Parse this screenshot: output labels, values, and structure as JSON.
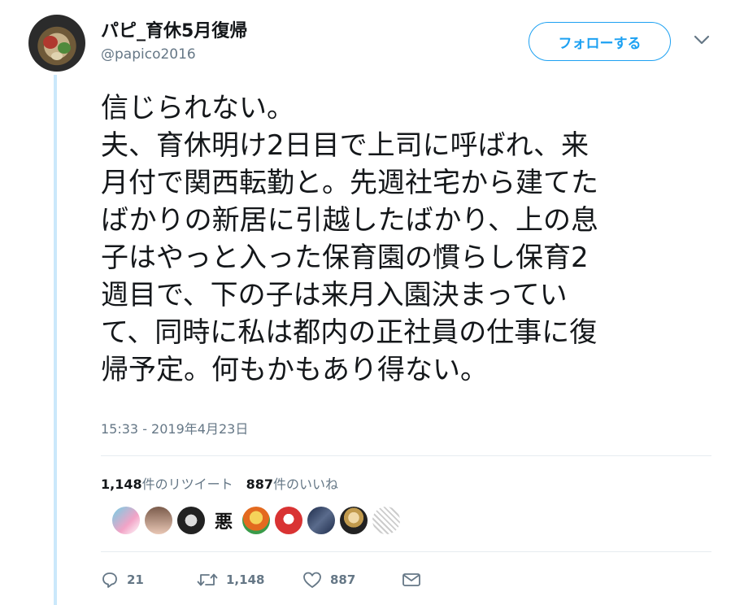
{
  "author": {
    "display_name": "パピ_育休5月復帰",
    "handle": "@papico2016"
  },
  "follow_button": {
    "label": "フォローする"
  },
  "tweet": {
    "lines": [
      "信じられない。",
      "夫、育休明け2日目で上司に呼ばれ、来",
      "月付で関西転勤と。先週社宅から建てた",
      "ばかりの新居に引越したばかり、上の息",
      "子はやっと入った保育園の慣らし保育2",
      "週目で、下の子は来月入園決まってい",
      "て、同時に私は都内の正社員の仕事に復",
      "帰予定。何もかもあり得ない。"
    ],
    "timestamp": "15:33 - 2019年4月23日"
  },
  "stats": {
    "retweets": "1,148",
    "retweets_suffix": "件のリツイート",
    "likes": "887",
    "likes_suffix": "件のいいね"
  },
  "liker_avatars": [
    "",
    "",
    "",
    "悪",
    "",
    "",
    "",
    "",
    ""
  ],
  "actions": {
    "reply_count": "21",
    "retweet_count": "1,148",
    "like_count": "887"
  },
  "colors": {
    "accent": "#1da1f2",
    "secondary_text": "#657786",
    "thread_line": "#cbe8fb"
  },
  "icons": [
    "chevron-down-icon",
    "reply-icon",
    "retweet-icon",
    "heart-icon",
    "mail-icon"
  ]
}
